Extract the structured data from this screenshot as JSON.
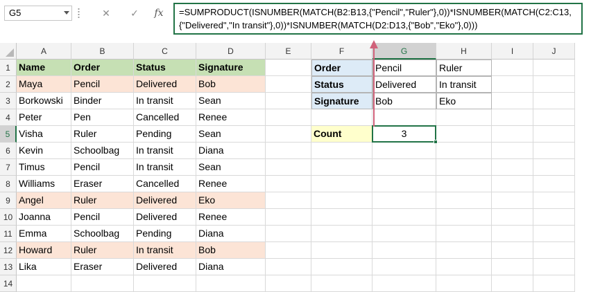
{
  "formula_bar": {
    "namebox": "G5",
    "cancel_glyph": "✕",
    "enter_glyph": "✓",
    "fx_glyph": "fx",
    "formula": "=SUMPRODUCT(ISNUMBER(MATCH(B2:B13,{\"Pencil\",\"Ruler\"},0))*ISNUMBER(MATCH(C2:C13,{\"Delivered\",\"In transit\"},0))*ISNUMBER(MATCH(D2:D13,{\"Bob\",\"Eko\"},0)))"
  },
  "colors": {
    "header_green": "#c6e0b4",
    "highlight_peach": "#fce4d6",
    "criteria_blue": "#ddebf7",
    "count_yellow": "#ffffcc",
    "selection_green": "#217346",
    "arrow_red": "#d0617a"
  },
  "columns": [
    "A",
    "B",
    "C",
    "D",
    "E",
    "F",
    "G",
    "H",
    "I",
    "J"
  ],
  "rows": [
    "1",
    "2",
    "3",
    "4",
    "5",
    "6",
    "7",
    "8",
    "9",
    "10",
    "11",
    "12",
    "13",
    "14"
  ],
  "table": {
    "headers": [
      "Name",
      "Order",
      "Status",
      "Signature"
    ],
    "rows": [
      {
        "cells": [
          "Maya",
          "Pencil",
          "Delivered",
          "Bob"
        ],
        "highlight": true
      },
      {
        "cells": [
          "Borkowski",
          "Binder",
          "In transit",
          "Sean"
        ],
        "highlight": false
      },
      {
        "cells": [
          "Peter",
          "Pen",
          "Cancelled",
          "Renee"
        ],
        "highlight": false
      },
      {
        "cells": [
          "Visha",
          "Ruler",
          "Pending",
          "Sean"
        ],
        "highlight": false
      },
      {
        "cells": [
          "Kevin",
          "Schoolbag",
          "In transit",
          "Diana"
        ],
        "highlight": false
      },
      {
        "cells": [
          "Timus",
          "Pencil",
          "In transit",
          "Sean"
        ],
        "highlight": false
      },
      {
        "cells": [
          "Williams",
          "Eraser",
          "Cancelled",
          "Renee"
        ],
        "highlight": false
      },
      {
        "cells": [
          "Angel",
          "Ruler",
          "Delivered",
          "Eko"
        ],
        "highlight": true
      },
      {
        "cells": [
          "Joanna",
          "Pencil",
          "Delivered",
          "Renee"
        ],
        "highlight": false
      },
      {
        "cells": [
          "Emma",
          "Schoolbag",
          "Pending",
          "Diana"
        ],
        "highlight": false
      },
      {
        "cells": [
          "Howard",
          "Ruler",
          "In transit",
          "Bob"
        ],
        "highlight": true
      },
      {
        "cells": [
          "Lika",
          "Eraser",
          "Delivered",
          "Diana"
        ],
        "highlight": false
      }
    ]
  },
  "criteria": [
    {
      "label": "Order",
      "values": [
        "Pencil",
        "Ruler"
      ]
    },
    {
      "label": "Status",
      "values": [
        "Delivered",
        "In transit"
      ]
    },
    {
      "label": "Signature",
      "values": [
        "Bob",
        "Eko"
      ]
    }
  ],
  "count": {
    "label": "Count",
    "value": "3"
  }
}
